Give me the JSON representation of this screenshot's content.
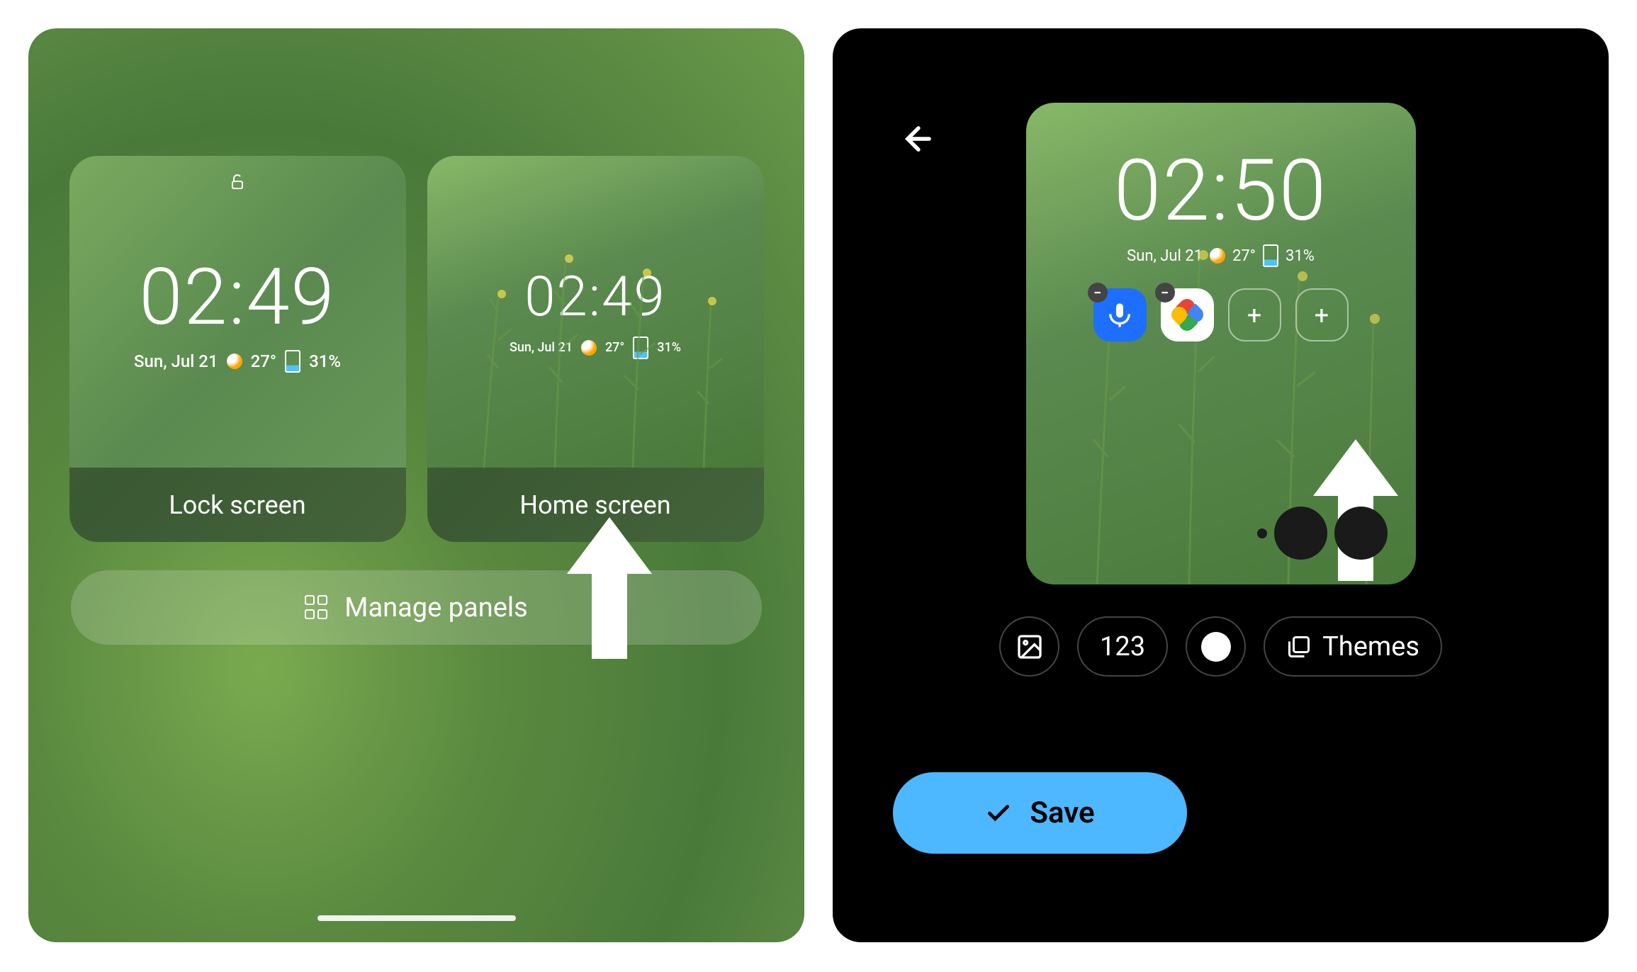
{
  "left": {
    "lock_card": {
      "label": "Lock screen",
      "time": "02:49",
      "date": "Sun, Jul 21",
      "temp": "27°",
      "battery": "31%"
    },
    "home_card": {
      "label": "Home screen",
      "time": "02:49",
      "date": "Sun, Jul 21",
      "temp": "27°",
      "battery": "31%"
    },
    "manage_label": "Manage panels"
  },
  "right": {
    "preview": {
      "time": "02:50",
      "date": "Sun, Jul 21",
      "temp": "27°",
      "battery": "31%"
    },
    "toolbar": {
      "numbers_label": "123",
      "themes_label": "Themes"
    },
    "save_label": "Save"
  }
}
